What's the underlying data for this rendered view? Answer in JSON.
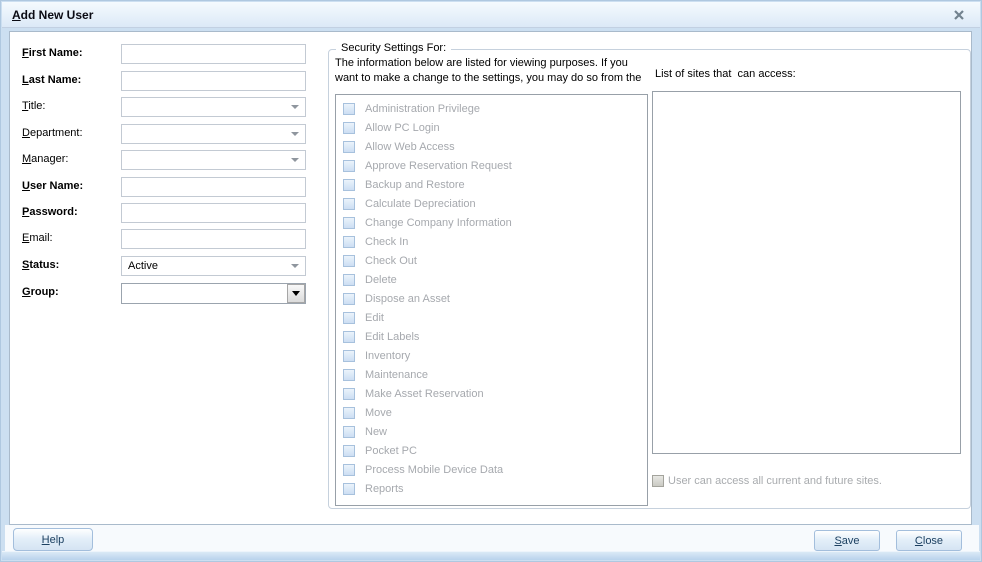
{
  "window": {
    "title": "Add New User"
  },
  "form": {
    "fields": [
      {
        "label": "First Name:",
        "type": "text",
        "bold": true,
        "value": ""
      },
      {
        "label": "Last Name:",
        "type": "text",
        "bold": true,
        "value": ""
      },
      {
        "label": "Title:",
        "type": "combo",
        "bold": false,
        "value": ""
      },
      {
        "label": "Department:",
        "type": "combo",
        "bold": false,
        "value": ""
      },
      {
        "label": "Manager:",
        "type": "combo",
        "bold": false,
        "value": ""
      },
      {
        "label": "User Name:",
        "type": "text",
        "bold": true,
        "value": ""
      },
      {
        "label": "Password:",
        "type": "text",
        "bold": true,
        "value": ""
      },
      {
        "label": "Email:",
        "type": "text",
        "bold": false,
        "value": ""
      },
      {
        "label": "Status:",
        "type": "combo",
        "bold": true,
        "value": "Active"
      },
      {
        "label": "Group:",
        "type": "combo3d",
        "bold": true,
        "value": ""
      }
    ]
  },
  "security": {
    "legend": "Security Settings For:",
    "description_line1": "The information below are listed for viewing purposes. If you",
    "description_line2": "want to make a change to the settings, you may do so from the",
    "privileges": [
      "Administration Privilege",
      "Allow PC Login",
      "Allow Web Access",
      "Approve Reservation Request",
      "Backup and Restore",
      "Calculate Depreciation",
      "Change Company Information",
      "Check In",
      "Check Out",
      "Delete",
      "Dispose an Asset",
      "Edit",
      "Edit Labels",
      "Inventory",
      "Maintenance",
      "Make Asset Reservation",
      "Move",
      "New",
      "Pocket PC",
      "Process Mobile Device Data",
      "Reports"
    ],
    "sites_label": "List of sites that  can access:",
    "all_sites_checkbox_label": "User can access all current and future sites."
  },
  "buttons": {
    "help": "Help",
    "save": "Save",
    "close": "Close"
  },
  "icons": {
    "titlebar_close": "close-icon",
    "combo_dropdown": "chevron-down-icon"
  },
  "colors": {
    "frame_blue": "#CCDFF1",
    "titlebar_gradient_top": "#F5FAFE",
    "titlebar_gradient_bottom": "#DCE9F7",
    "disabled_text": "#A6A9AE",
    "disabled_checkbox_blue": "#CCDEF3",
    "disabled_checkbox_gray": "#CACAC3",
    "button_text": "#1C4061",
    "button_border": "#A3BEDC"
  }
}
